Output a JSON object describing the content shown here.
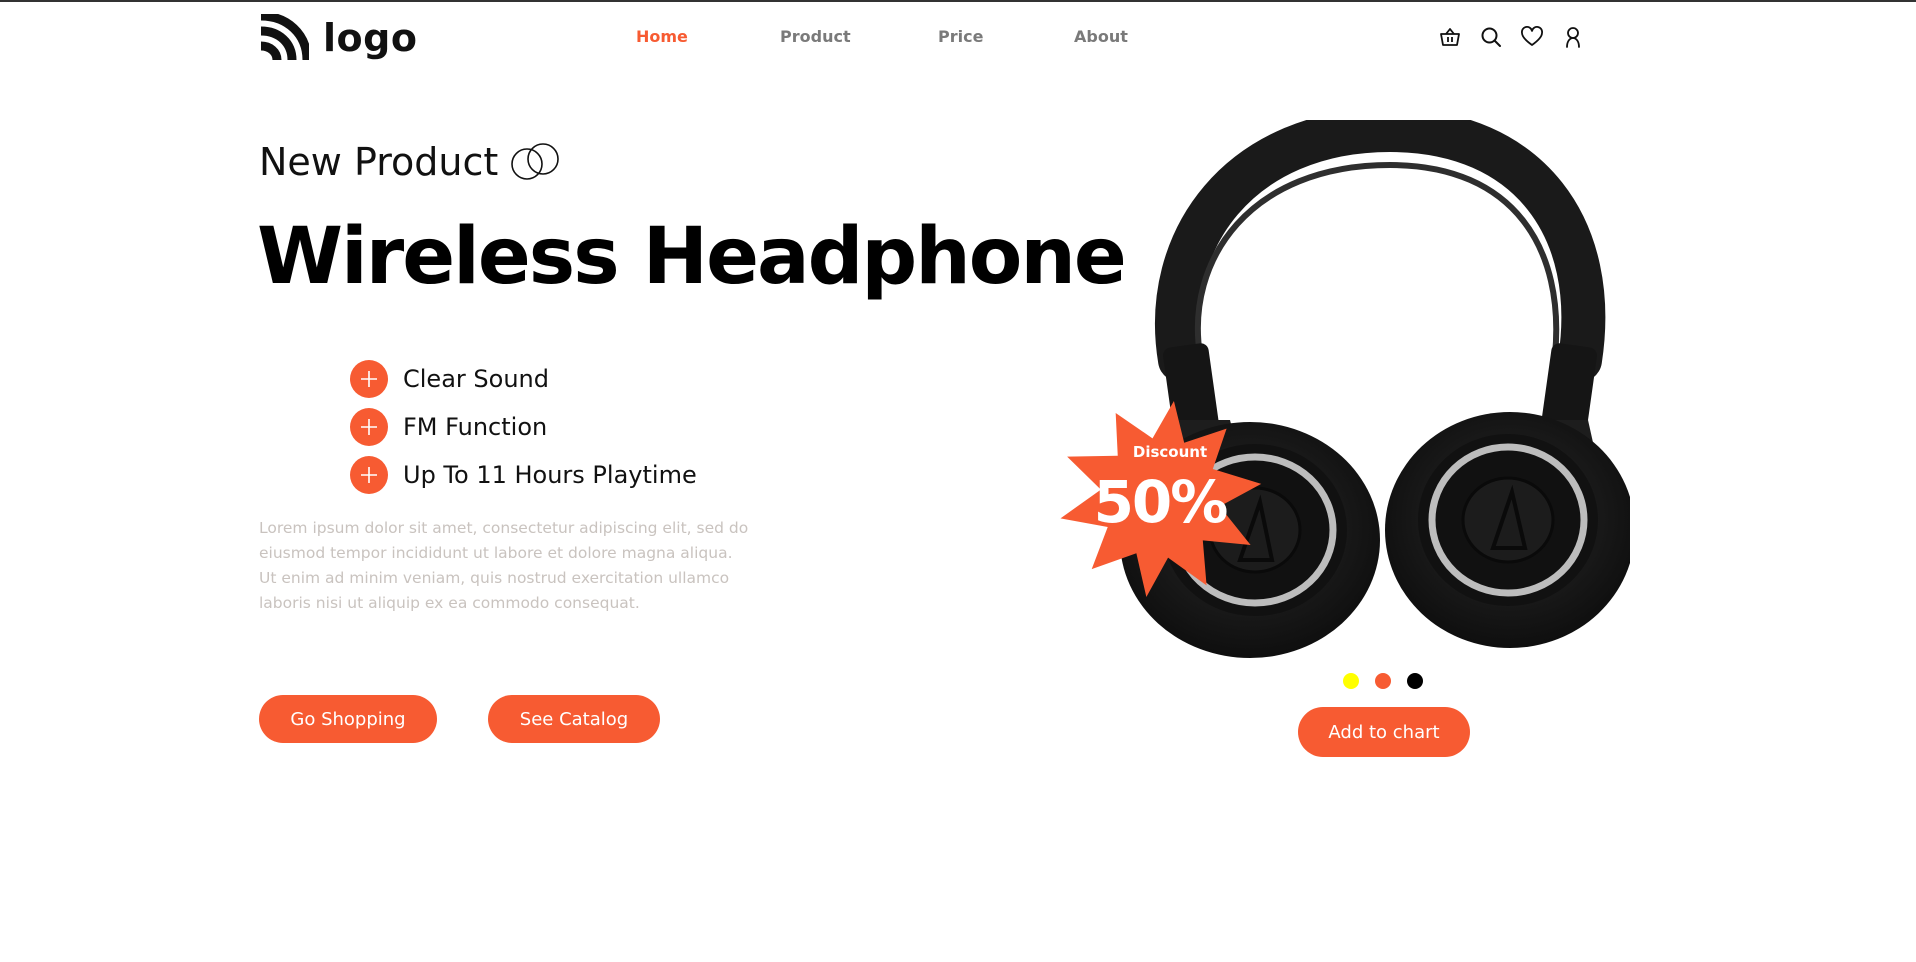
{
  "brand": {
    "logo_text": "logo"
  },
  "nav": {
    "items": [
      {
        "label": "Home",
        "active": true
      },
      {
        "label": "Product",
        "active": false
      },
      {
        "label": "Price",
        "active": false
      },
      {
        "label": "About",
        "active": false
      }
    ]
  },
  "header_icons": [
    "basket-icon",
    "search-icon",
    "heart-icon",
    "user-icon"
  ],
  "hero": {
    "subtitle": "New Product",
    "title": "Wireless Headphone",
    "features": [
      "Clear Sound",
      "FM Function",
      "Up To 11 Hours Playtime"
    ],
    "description": "Lorem ipsum dolor sit amet, consectetur adipiscing elit, sed do eiusmod tempor incididunt ut labore et dolore magna aliqua. Ut enim ad minim veniam, quis nostrud exercitation ullamco laboris nisi ut aliquip ex ea commodo consequat.",
    "buttons": {
      "shop": "Go Shopping",
      "catalog": "See Catalog"
    }
  },
  "product": {
    "badge_label": "Discount",
    "badge_value": "50%",
    "colors": [
      "#ffff00",
      "#f75b32",
      "#000000"
    ],
    "cta": "Add to chart"
  },
  "theme": {
    "accent": "#f75b32",
    "text": "#111111",
    "muted": "#c9c3bf"
  }
}
